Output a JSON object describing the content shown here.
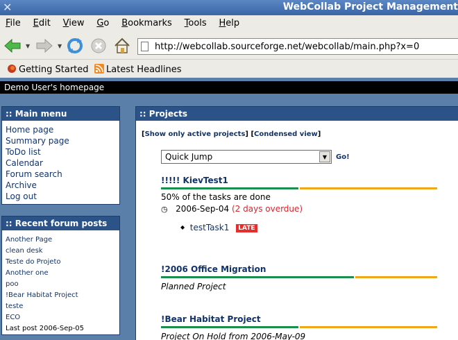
{
  "window": {
    "title": "WebCollab Project Management"
  },
  "menubar": [
    "File",
    "Edit",
    "View",
    "Go",
    "Bookmarks",
    "Tools",
    "Help"
  ],
  "navbar": {
    "url": "http://webcollab.sourceforge.net/webcollab/main.php?x=0"
  },
  "bookmarks": [
    {
      "label": "Getting Started",
      "icon": "firefox-icon"
    },
    {
      "label": "Latest Headlines",
      "icon": "rss-icon"
    }
  ],
  "page_header": "Demo User's homepage",
  "main_menu": {
    "title": ":: Main menu",
    "items": [
      "Home page",
      "Summary page",
      "ToDo list",
      "Calendar",
      "Forum search",
      "Archive",
      "Log out"
    ]
  },
  "forum": {
    "title": ":: Recent forum posts",
    "items": [
      "Another Page",
      "clean desk",
      "Teste do Projeto",
      "Another one",
      "poo",
      "!Bear Habitat Project",
      "teste",
      "ECO"
    ],
    "last_post": "Last post 2006-Sep-05"
  },
  "projects": {
    "title": ":: Projects",
    "show_active": "Show only active projects",
    "condensed": "Condensed view",
    "bracket_open": "[",
    "bracket_close": "]",
    "quick_jump": "Quick Jump",
    "go": "Go!",
    "list": [
      {
        "name": "!!!!! KievTest1",
        "progress": 0.5,
        "status": "50% of the tasks are done",
        "due": "2006-Sep-04",
        "overdue": "(2 days overdue)",
        "task": "testTask1",
        "task_badge": "LATE"
      },
      {
        "name": "!2006 Office Migration",
        "progress": 0.7,
        "status": "Planned Project"
      },
      {
        "name": "!Bear Habitat Project",
        "progress": 0.5,
        "status": "Project On Hold from 2006-May-09"
      }
    ]
  },
  "colors": {
    "box_header": "#2b5387",
    "link": "#11336b",
    "progress_done": "#1a8f4a",
    "progress_todo": "#f0a818",
    "overdue": "#d8252d",
    "late_badge": "#e52e2e"
  }
}
